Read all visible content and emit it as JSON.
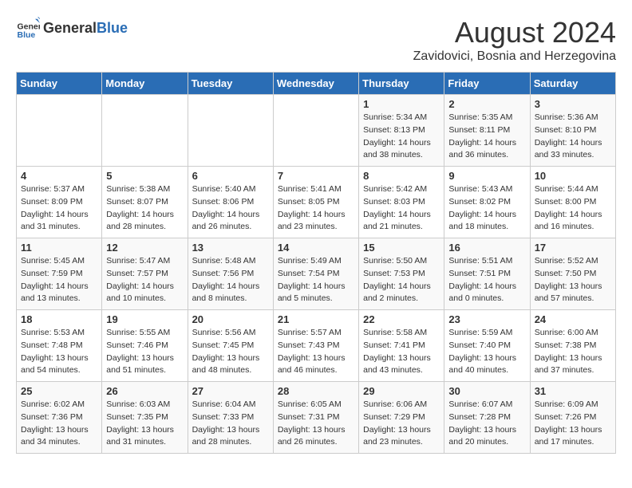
{
  "header": {
    "logo_general": "General",
    "logo_blue": "Blue",
    "month_title": "August 2024",
    "subtitle": "Zavidovici, Bosnia and Herzegovina"
  },
  "days_of_week": [
    "Sunday",
    "Monday",
    "Tuesday",
    "Wednesday",
    "Thursday",
    "Friday",
    "Saturday"
  ],
  "weeks": [
    [
      {
        "day": "",
        "info": ""
      },
      {
        "day": "",
        "info": ""
      },
      {
        "day": "",
        "info": ""
      },
      {
        "day": "",
        "info": ""
      },
      {
        "day": "1",
        "info": "Sunrise: 5:34 AM\nSunset: 8:13 PM\nDaylight: 14 hours\nand 38 minutes."
      },
      {
        "day": "2",
        "info": "Sunrise: 5:35 AM\nSunset: 8:11 PM\nDaylight: 14 hours\nand 36 minutes."
      },
      {
        "day": "3",
        "info": "Sunrise: 5:36 AM\nSunset: 8:10 PM\nDaylight: 14 hours\nand 33 minutes."
      }
    ],
    [
      {
        "day": "4",
        "info": "Sunrise: 5:37 AM\nSunset: 8:09 PM\nDaylight: 14 hours\nand 31 minutes."
      },
      {
        "day": "5",
        "info": "Sunrise: 5:38 AM\nSunset: 8:07 PM\nDaylight: 14 hours\nand 28 minutes."
      },
      {
        "day": "6",
        "info": "Sunrise: 5:40 AM\nSunset: 8:06 PM\nDaylight: 14 hours\nand 26 minutes."
      },
      {
        "day": "7",
        "info": "Sunrise: 5:41 AM\nSunset: 8:05 PM\nDaylight: 14 hours\nand 23 minutes."
      },
      {
        "day": "8",
        "info": "Sunrise: 5:42 AM\nSunset: 8:03 PM\nDaylight: 14 hours\nand 21 minutes."
      },
      {
        "day": "9",
        "info": "Sunrise: 5:43 AM\nSunset: 8:02 PM\nDaylight: 14 hours\nand 18 minutes."
      },
      {
        "day": "10",
        "info": "Sunrise: 5:44 AM\nSunset: 8:00 PM\nDaylight: 14 hours\nand 16 minutes."
      }
    ],
    [
      {
        "day": "11",
        "info": "Sunrise: 5:45 AM\nSunset: 7:59 PM\nDaylight: 14 hours\nand 13 minutes."
      },
      {
        "day": "12",
        "info": "Sunrise: 5:47 AM\nSunset: 7:57 PM\nDaylight: 14 hours\nand 10 minutes."
      },
      {
        "day": "13",
        "info": "Sunrise: 5:48 AM\nSunset: 7:56 PM\nDaylight: 14 hours\nand 8 minutes."
      },
      {
        "day": "14",
        "info": "Sunrise: 5:49 AM\nSunset: 7:54 PM\nDaylight: 14 hours\nand 5 minutes."
      },
      {
        "day": "15",
        "info": "Sunrise: 5:50 AM\nSunset: 7:53 PM\nDaylight: 14 hours\nand 2 minutes."
      },
      {
        "day": "16",
        "info": "Sunrise: 5:51 AM\nSunset: 7:51 PM\nDaylight: 14 hours\nand 0 minutes."
      },
      {
        "day": "17",
        "info": "Sunrise: 5:52 AM\nSunset: 7:50 PM\nDaylight: 13 hours\nand 57 minutes."
      }
    ],
    [
      {
        "day": "18",
        "info": "Sunrise: 5:53 AM\nSunset: 7:48 PM\nDaylight: 13 hours\nand 54 minutes."
      },
      {
        "day": "19",
        "info": "Sunrise: 5:55 AM\nSunset: 7:46 PM\nDaylight: 13 hours\nand 51 minutes."
      },
      {
        "day": "20",
        "info": "Sunrise: 5:56 AM\nSunset: 7:45 PM\nDaylight: 13 hours\nand 48 minutes."
      },
      {
        "day": "21",
        "info": "Sunrise: 5:57 AM\nSunset: 7:43 PM\nDaylight: 13 hours\nand 46 minutes."
      },
      {
        "day": "22",
        "info": "Sunrise: 5:58 AM\nSunset: 7:41 PM\nDaylight: 13 hours\nand 43 minutes."
      },
      {
        "day": "23",
        "info": "Sunrise: 5:59 AM\nSunset: 7:40 PM\nDaylight: 13 hours\nand 40 minutes."
      },
      {
        "day": "24",
        "info": "Sunrise: 6:00 AM\nSunset: 7:38 PM\nDaylight: 13 hours\nand 37 minutes."
      }
    ],
    [
      {
        "day": "25",
        "info": "Sunrise: 6:02 AM\nSunset: 7:36 PM\nDaylight: 13 hours\nand 34 minutes."
      },
      {
        "day": "26",
        "info": "Sunrise: 6:03 AM\nSunset: 7:35 PM\nDaylight: 13 hours\nand 31 minutes."
      },
      {
        "day": "27",
        "info": "Sunrise: 6:04 AM\nSunset: 7:33 PM\nDaylight: 13 hours\nand 28 minutes."
      },
      {
        "day": "28",
        "info": "Sunrise: 6:05 AM\nSunset: 7:31 PM\nDaylight: 13 hours\nand 26 minutes."
      },
      {
        "day": "29",
        "info": "Sunrise: 6:06 AM\nSunset: 7:29 PM\nDaylight: 13 hours\nand 23 minutes."
      },
      {
        "day": "30",
        "info": "Sunrise: 6:07 AM\nSunset: 7:28 PM\nDaylight: 13 hours\nand 20 minutes."
      },
      {
        "day": "31",
        "info": "Sunrise: 6:09 AM\nSunset: 7:26 PM\nDaylight: 13 hours\nand 17 minutes."
      }
    ]
  ]
}
